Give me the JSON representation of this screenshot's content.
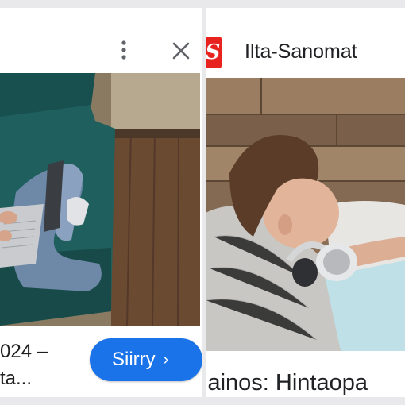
{
  "left_card": {
    "headline_line1": "024 –",
    "headline_line2": "ta...",
    "cta_label": "Siirry",
    "cta_chevron": "›",
    "icons": [
      "more-vertical-icon",
      "close-icon"
    ]
  },
  "right_card": {
    "publisher_logo_letter": "S",
    "publisher_name": "Ilta-Sanomat",
    "headline": "lainos: Hintaopa"
  },
  "colors": {
    "cta_blue": "#1a73e8",
    "logo_red": "#e8231f",
    "card_bg": "#ffffff",
    "page_bg": "#e9e9ec"
  }
}
